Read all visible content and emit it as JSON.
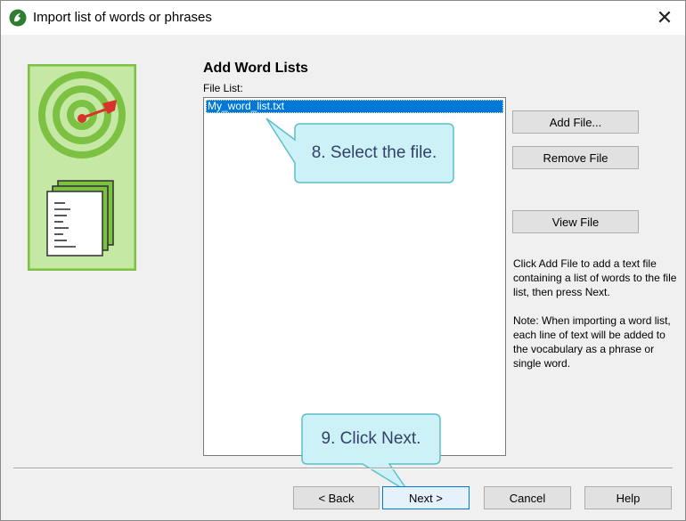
{
  "window": {
    "title": "Import list of words or phrases"
  },
  "main": {
    "heading": "Add Word Lists",
    "file_list_label": "File List:",
    "files": [
      "My_word_list.txt"
    ]
  },
  "buttons": {
    "add_file": "Add File...",
    "remove_file": "Remove File",
    "view_file": "View File",
    "back": "< Back",
    "next": "Next >",
    "cancel": "Cancel",
    "help": "Help"
  },
  "help_text": {
    "instructions": "Click Add File to add a text file containing a list of words to the file list, then press Next.",
    "note": "Note: When importing a word list, each line of text will be added to the vocabulary as a phrase or single word."
  },
  "callouts": {
    "step8": "8. Select the file.",
    "step9": "9. Click Next."
  },
  "colors": {
    "accent_green": "#7dc142",
    "selection_blue": "#0078d7",
    "callout_fill": "#ccf2f7",
    "callout_border": "#5bc0c8"
  }
}
